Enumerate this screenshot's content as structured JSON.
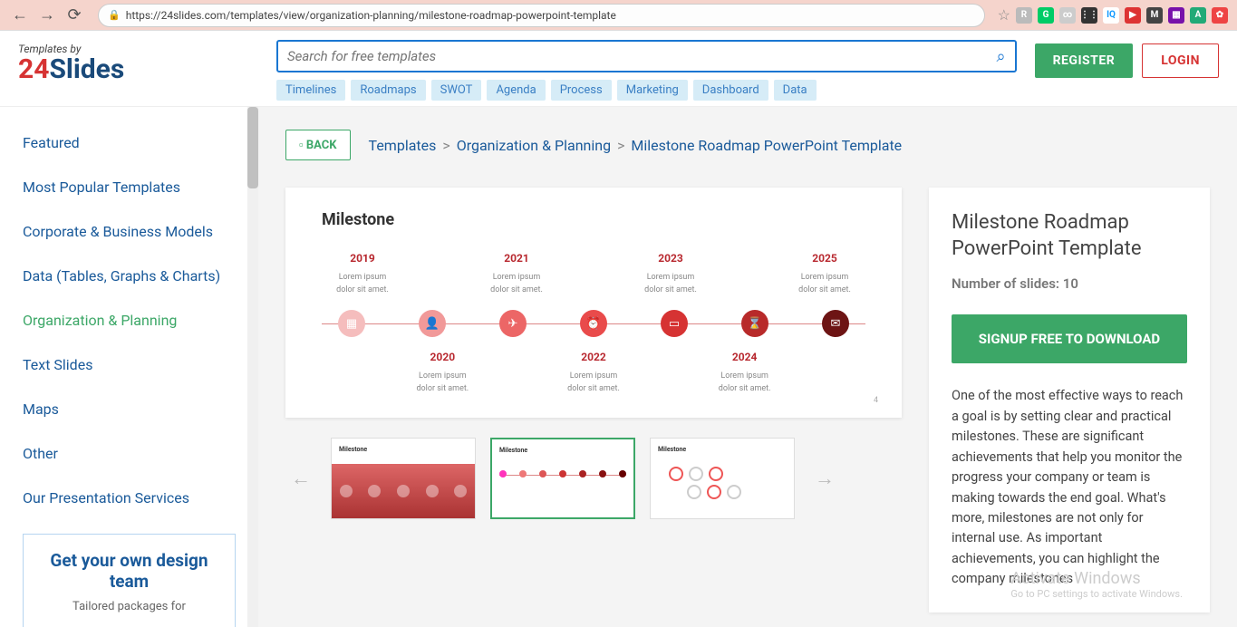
{
  "browser": {
    "url": "https://24slides.com/templates/view/organization-planning/milestone-roadmap-powerpoint-template",
    "extensions": [
      {
        "bg": "#bbb",
        "label": "R"
      },
      {
        "bg": "#0c6",
        "label": "G"
      },
      {
        "bg": "#ccc",
        "label": "∞"
      },
      {
        "bg": "#333",
        "label": "⋮⋮"
      },
      {
        "bg": "#fff",
        "label": "IQ",
        "color": "#19f"
      },
      {
        "bg": "#d33",
        "label": "▶"
      },
      {
        "bg": "#444",
        "label": "M"
      },
      {
        "bg": "#71a",
        "label": "▦"
      },
      {
        "bg": "#2a7",
        "label": "A"
      },
      {
        "bg": "#e44",
        "label": "✿"
      }
    ]
  },
  "header": {
    "logo_tag": "Templates by",
    "logo_text_a": "24",
    "logo_text_b": "Slides",
    "search_placeholder": "Search for free templates",
    "tags": [
      "Timelines",
      "Roadmaps",
      "SWOT",
      "Agenda",
      "Process",
      "Marketing",
      "Dashboard",
      "Data"
    ],
    "register": "REGISTER",
    "login": "LOGIN"
  },
  "sidebar": {
    "items": [
      {
        "label": "Featured",
        "active": false
      },
      {
        "label": "Most Popular Templates",
        "active": false
      },
      {
        "label": "Corporate & Business Models",
        "active": false
      },
      {
        "label": "Data (Tables, Graphs & Charts)",
        "active": false
      },
      {
        "label": "Organization & Planning",
        "active": true
      },
      {
        "label": "Text Slides",
        "active": false
      },
      {
        "label": "Maps",
        "active": false
      },
      {
        "label": "Other",
        "active": false
      },
      {
        "label": "Our Presentation Services",
        "active": false
      }
    ],
    "promo_title": "Get your own design team",
    "promo_sub": "Tailored packages for"
  },
  "content": {
    "back": "BACK",
    "breadcrumb": [
      "Templates",
      "Organization & Planning",
      "Milestone Roadmap PowerPoint Template"
    ],
    "slide": {
      "title": "Milestone",
      "top_years": [
        "2019",
        "2021",
        "2023",
        "2025"
      ],
      "bot_years": [
        "2020",
        "2022",
        "2024"
      ],
      "lorem": "Lorem ipsum dolor sit amet.",
      "page_num": "4",
      "dot_colors": [
        "#f5bdbd",
        "#f19999",
        "#ec6666",
        "#e94b4b",
        "#d63333",
        "#b82a2a",
        "#6d1414"
      ],
      "dot_icons": [
        "▦",
        "👤",
        "✈",
        "⏰",
        "▭",
        "⌛",
        "✉"
      ]
    },
    "thumbs_title": "Milestone"
  },
  "info": {
    "title": "Milestone Roadmap PowerPoint Template",
    "slides_label": "Number of slides: 10",
    "signup": "SIGNUP FREE TO DOWNLOAD",
    "desc": "One of the most effective ways to reach a goal is by setting clear and practical milestones. These are significant achievements that help you monitor the progress your company or team is making towards the end goal. What's more, milestones are not only for internal use. As important achievements, you can highlight the company milestones"
  },
  "watermark": {
    "line1": "Activate Windows",
    "line2": "Go to PC settings to activate Windows."
  }
}
